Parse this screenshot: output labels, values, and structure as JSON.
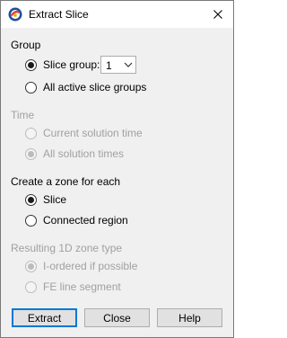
{
  "window": {
    "title": "Extract Slice"
  },
  "icons": {
    "app": "tecplot-app-icon",
    "close": "close-icon",
    "dropdown": "chevron-down-icon"
  },
  "group": {
    "heading": "Group",
    "slice_group_label": "Slice group:",
    "slice_group_value": "1",
    "all_active_label": "All active slice groups",
    "selected": "slice_group"
  },
  "time": {
    "heading": "Time",
    "current_label": "Current solution time",
    "all_label": "All solution times",
    "selected": "all",
    "enabled": false
  },
  "zone_for_each": {
    "heading": "Create a zone for each",
    "slice_label": "Slice",
    "connected_label": "Connected region",
    "selected": "slice"
  },
  "zone_type": {
    "heading": "Resulting 1D zone type",
    "iordered_label": "I-ordered if possible",
    "fe_label": "FE line segment",
    "selected": "iordered",
    "enabled": false
  },
  "buttons": {
    "extract": "Extract",
    "close": "Close",
    "help": "Help"
  },
  "colors": {
    "default_button_border": "#0078d7",
    "disabled_text": "#a0a0a0"
  }
}
